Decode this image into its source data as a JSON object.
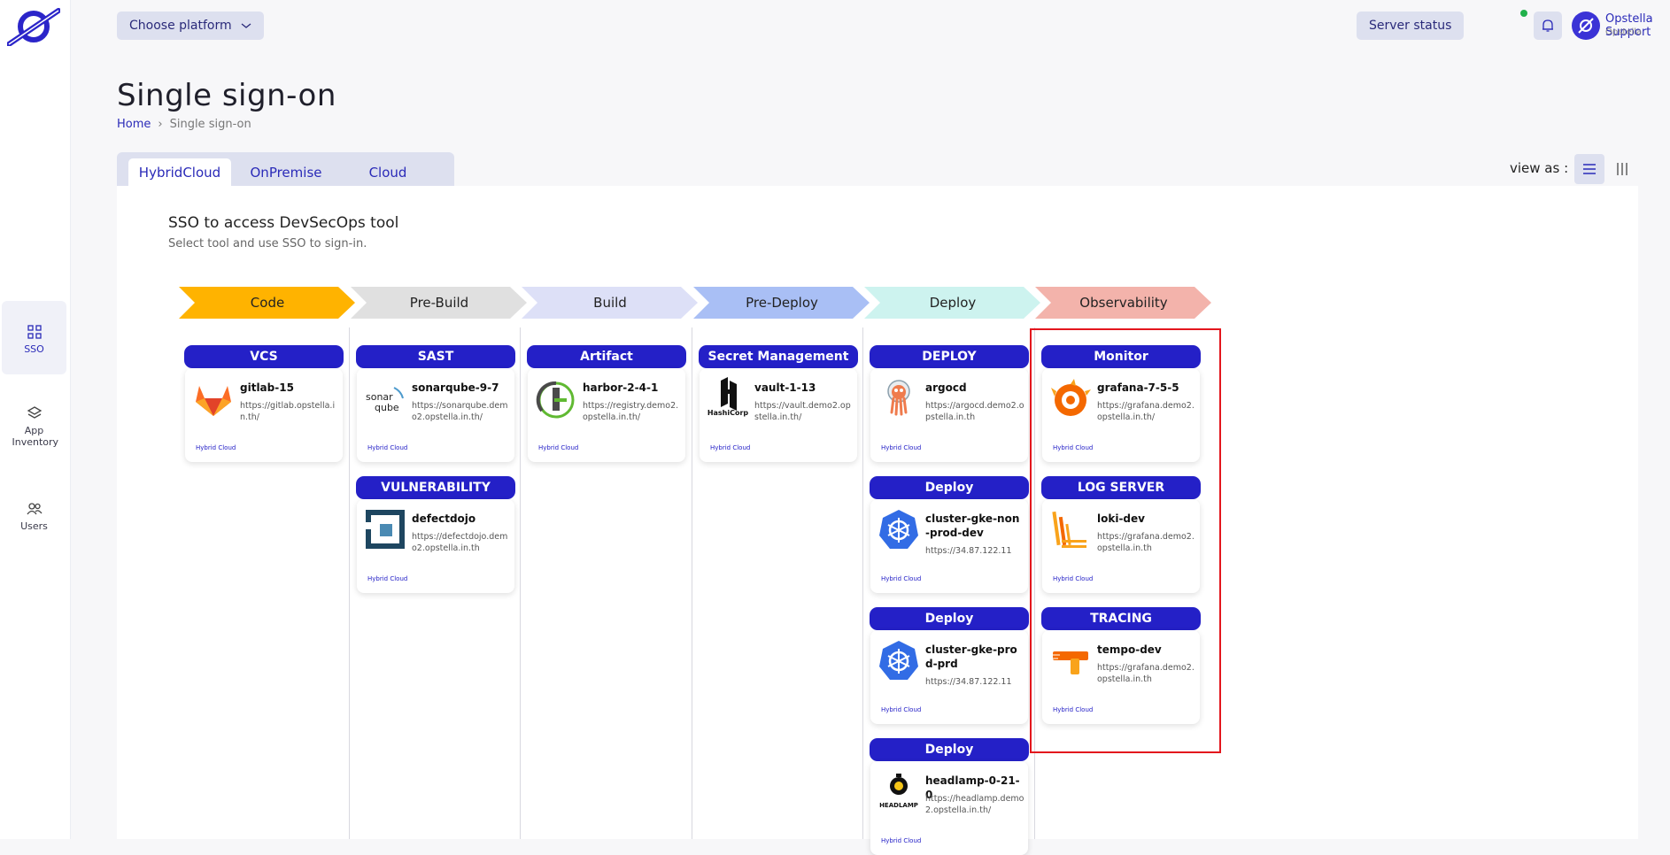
{
  "sidebar": {
    "items": [
      {
        "label": "SSO",
        "icon": "grid-icon"
      },
      {
        "label": "App Inventory",
        "icon": "layers-icon"
      },
      {
        "label": "Users",
        "icon": "users-icon"
      }
    ]
  },
  "topbar": {
    "platform_label": "Choose platform",
    "server_status_label": "Server status",
    "user_name": "Opstella Support",
    "user_org": "Opstella"
  },
  "page": {
    "title": "Single sign-on",
    "breadcrumb": {
      "home": "Home",
      "separator": "›",
      "current": "Single sign-on"
    }
  },
  "tabs": [
    "HybridCloud",
    "OnPremise",
    "Cloud"
  ],
  "view_as_label": "view as :",
  "panel": {
    "title": "SSO to access DevSecOps tool",
    "subtitle": "Select tool and use SSO to sign-in."
  },
  "stages": [
    {
      "label": "Code",
      "color": "#ffb300"
    },
    {
      "label": "Pre-Build",
      "color": "#e0e0e0"
    },
    {
      "label": "Build",
      "color": "#dde0f7"
    },
    {
      "label": "Pre-Deploy",
      "color": "#a9bff5"
    },
    {
      "label": "Deploy",
      "color": "#cdf3ef"
    },
    {
      "label": "Observability",
      "color": "#f3b3ab"
    }
  ],
  "columns": [
    {
      "groups": [
        {
          "category": "VCS",
          "name": "gitlab-15",
          "url": "https://gitlab.opstella.in.th/",
          "tag": "Hybrid Cloud",
          "logo": "gitlab-icon"
        }
      ]
    },
    {
      "groups": [
        {
          "category": "SAST",
          "name": "sonarqube-9-7",
          "url": "https://sonarqube.demo2.opstella.in.th/",
          "tag": "Hybrid Cloud",
          "logo": "sonarqube-icon"
        },
        {
          "category": "VULNERABILITY",
          "name": "defectdojo",
          "url": "https://defectdojo.demo2.opstella.in.th",
          "tag": "Hybrid Cloud",
          "logo": "defectdojo-icon"
        }
      ]
    },
    {
      "groups": [
        {
          "category": "Artifact",
          "name": "harbor-2-4-1",
          "url": "https://registry.demo2.opstella.in.th/",
          "tag": "Hybrid Cloud",
          "logo": "harbor-icon"
        }
      ]
    },
    {
      "groups": [
        {
          "category": "Secret Management",
          "name": "vault-1-13",
          "url": "https://vault.demo2.opstella.in.th/",
          "tag": "Hybrid Cloud",
          "logo": "hashicorp-icon",
          "logo_text": "HashiCorp"
        }
      ]
    },
    {
      "groups": [
        {
          "category": "DEPLOY",
          "name": "argocd",
          "url": "https://argocd.demo2.opstella.in.th",
          "tag": "Hybrid Cloud",
          "logo": "argocd-icon"
        },
        {
          "category": "Deploy",
          "name": "cluster-gke-non-prod-dev",
          "url": "https://34.87.122.11",
          "tag": "Hybrid Cloud",
          "logo": "kubernetes-icon"
        },
        {
          "category": "Deploy",
          "name": "cluster-gke-prod-prd",
          "url": "https://34.87.122.11",
          "tag": "Hybrid Cloud",
          "logo": "kubernetes-icon"
        },
        {
          "category": "Deploy",
          "name": "headlamp-0-21-0",
          "url": "https://headlamp.demo2.opstella.in.th/",
          "tag": "Hybrid Cloud",
          "logo": "headlamp-icon",
          "logo_text": "HEADLAMP"
        }
      ]
    },
    {
      "groups": [
        {
          "category": "Monitor",
          "name": "grafana-7-5-5",
          "url": "https://grafana.demo2.opstella.in.th/",
          "tag": "Hybrid Cloud",
          "logo": "grafana-icon"
        },
        {
          "category": "LOG SERVER",
          "name": "loki-dev",
          "url": "https://grafana.demo2.opstella.in.th",
          "tag": "Hybrid Cloud",
          "logo": "loki-icon"
        },
        {
          "category": "TRACING",
          "name": "tempo-dev",
          "url": "https://grafana.demo2.opstella.in.th",
          "tag": "Hybrid Cloud",
          "logo": "tempo-icon"
        }
      ]
    }
  ],
  "colors": {
    "accent": "#2420c7",
    "highlight": "#e3161d"
  }
}
